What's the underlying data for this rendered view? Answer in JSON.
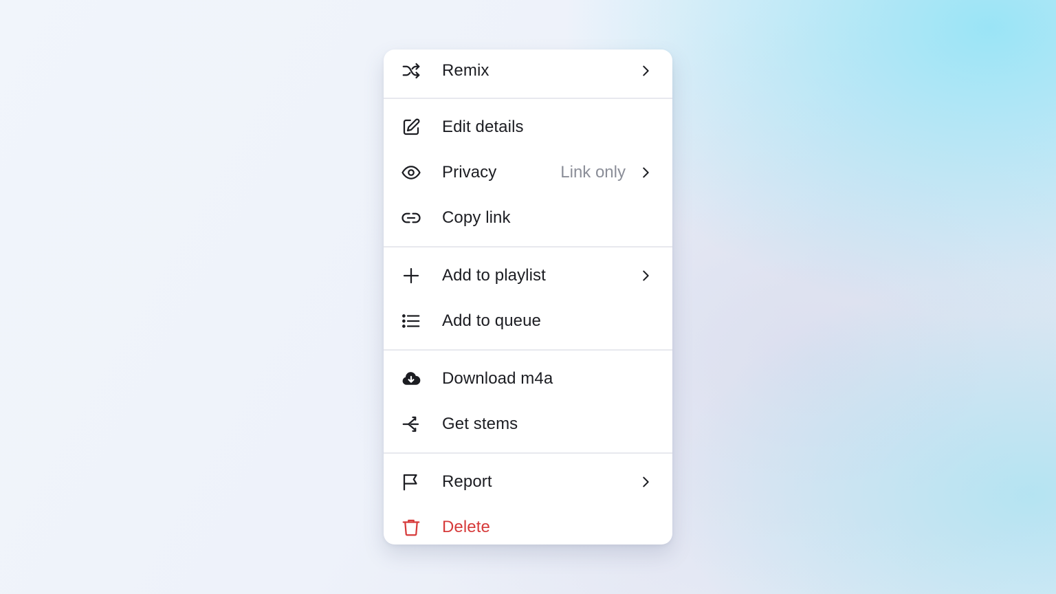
{
  "menu": {
    "remix": {
      "label": "Remix",
      "icon": "shuffle-icon"
    },
    "edit_details": {
      "label": "Edit details",
      "icon": "edit-icon"
    },
    "privacy": {
      "label": "Privacy",
      "value": "Link only",
      "icon": "eye-icon"
    },
    "copy_link": {
      "label": "Copy link",
      "icon": "link-icon"
    },
    "add_to_playlist": {
      "label": "Add to playlist",
      "icon": "plus-icon"
    },
    "add_to_queue": {
      "label": "Add to queue",
      "icon": "list-icon"
    },
    "download": {
      "label": "Download m4a",
      "icon": "cloud-download-icon"
    },
    "get_stems": {
      "label": "Get stems",
      "icon": "split-icon"
    },
    "report": {
      "label": "Report",
      "icon": "flag-icon"
    },
    "delete": {
      "label": "Delete",
      "icon": "trash-icon",
      "color": "#d63a3a"
    }
  },
  "colors": {
    "text": "#1c1d22",
    "muted": "#8b8e98",
    "danger": "#d63a3a",
    "divider": "#e7e8ee"
  }
}
